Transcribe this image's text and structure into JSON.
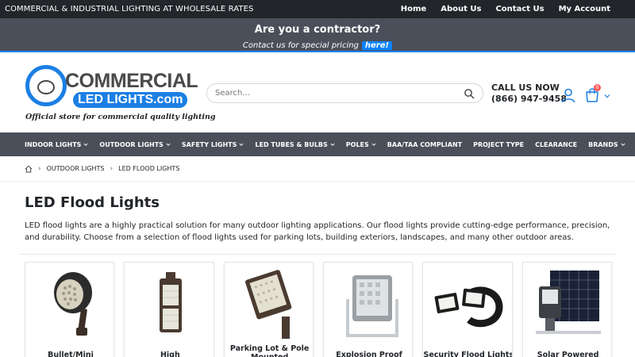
{
  "topbar": {
    "tagline": "COMMERCIAL & INDUSTRIAL LIGHTING AT WHOLESALE RATES",
    "links": [
      "Home",
      "About Us",
      "Contact Us",
      "My Account"
    ]
  },
  "promo": {
    "title": "Are you a contractor?",
    "subtitle": "Contact us for special pricing",
    "link": "here!"
  },
  "logo": {
    "word1": "COMMERCIAL",
    "word2": "LED LIGHTS.com",
    "tagline": "Official store for commercial quality lighting"
  },
  "search": {
    "placeholder": "Search..."
  },
  "contact": {
    "call_label": "CALL US NOW",
    "phone": "(866) 947-9458"
  },
  "cart": {
    "count": "0"
  },
  "nav": [
    {
      "label": "INDOOR LIGHTS",
      "dropdown": true
    },
    {
      "label": "OUTDOOR LIGHTS",
      "dropdown": true
    },
    {
      "label": "SAFETY LIGHTS",
      "dropdown": true
    },
    {
      "label": "LED TUBES & BULBS",
      "dropdown": true
    },
    {
      "label": "POLES",
      "dropdown": true
    },
    {
      "label": "BAA/TAA COMPLIANT",
      "dropdown": false
    },
    {
      "label": "PROJECT TYPE",
      "dropdown": false
    },
    {
      "label": "CLEARANCE",
      "dropdown": false
    },
    {
      "label": "BRANDS",
      "dropdown": true
    }
  ],
  "breadcrumb": [
    "OUTDOOR LIGHTS",
    "LED FLOOD LIGHTS"
  ],
  "page": {
    "title": "LED Flood Lights",
    "description": "LED flood lights are a highly practical solution for many outdoor lighting applications. Our flood lights provide cutting-edge performance, precision, and durability. Choose from a selection of flood lights used for parking lots, building exteriors, landscapes, and many other outdoor areas."
  },
  "categories": [
    {
      "label": "Bullet/Mini"
    },
    {
      "label": "High Powered/Stadium"
    },
    {
      "label": "Parking Lot & Pole Mounted"
    },
    {
      "label": "Explosion Proof"
    },
    {
      "label": "Security Flood Lights"
    },
    {
      "label": "Solar Powered"
    }
  ],
  "colors": {
    "dark": "#222529",
    "nav": "#4b4f5a",
    "accent": "#0a84ff",
    "badge": "#ff5b5b"
  }
}
